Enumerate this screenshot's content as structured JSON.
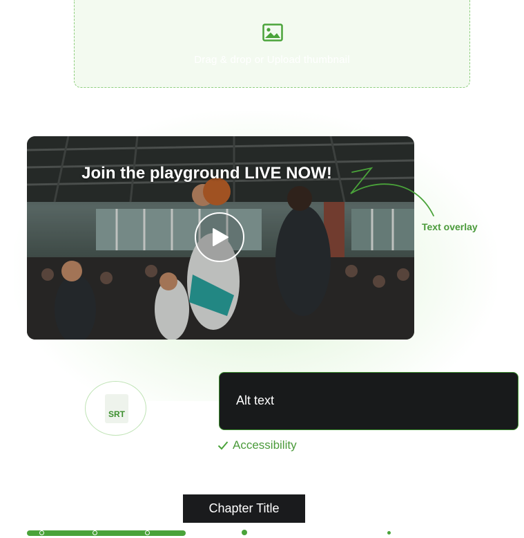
{
  "upload": {
    "label": "Drag & drop or Upload thumbnail",
    "icon": "image-icon"
  },
  "video": {
    "headline": "Join the playground LIVE NOW!",
    "play_icon": "play-icon"
  },
  "annotations": {
    "text_overlay": "Text overlay",
    "accessibility": "Accessibility"
  },
  "captions": {
    "file_label": "SRT",
    "icon": "file-icon"
  },
  "alt_text": {
    "label": "Alt text"
  },
  "chapter": {
    "title": "Chapter Title"
  },
  "timeline": {
    "progress_fraction": 0.32
  },
  "colors": {
    "accent": "#4aa33a",
    "dark_panel": "#181a1b"
  }
}
